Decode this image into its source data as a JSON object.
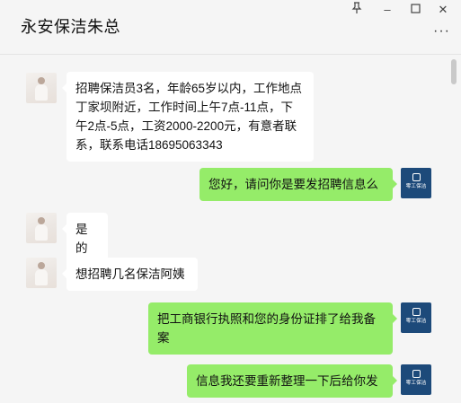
{
  "window": {
    "title": "永安保洁朱总",
    "controls": {
      "pin_icon": "pin-icon",
      "minimize_glyph": "–",
      "maximize_glyph": "☐",
      "close_glyph": "✕",
      "more_glyph": "···"
    }
  },
  "right_avatar": {
    "label": "零工保洁"
  },
  "messages": [
    {
      "side": "left",
      "text": "招聘保洁员3名，年龄65岁以内，工作地点丁家坝附近，工作时间上午7点-11点，下午2点-5点，工资2000-2200元，有意者联系，联系电话18695063343"
    },
    {
      "side": "right",
      "text": "您好，请问你是要发招聘信息么"
    },
    {
      "side": "left",
      "text": "是的"
    },
    {
      "side": "left",
      "text": "想招聘几名保洁阿姨"
    },
    {
      "side": "right",
      "text": "把工商银行执照和您的身份证排了给我备案"
    },
    {
      "side": "right",
      "text": "信息我还要重新整理一下后给你发"
    }
  ],
  "colors": {
    "outgoing_bubble": "#95ec69",
    "incoming_bubble": "#ffffff",
    "background": "#f5f5f5",
    "brand_avatar": "#1d4a7a"
  }
}
